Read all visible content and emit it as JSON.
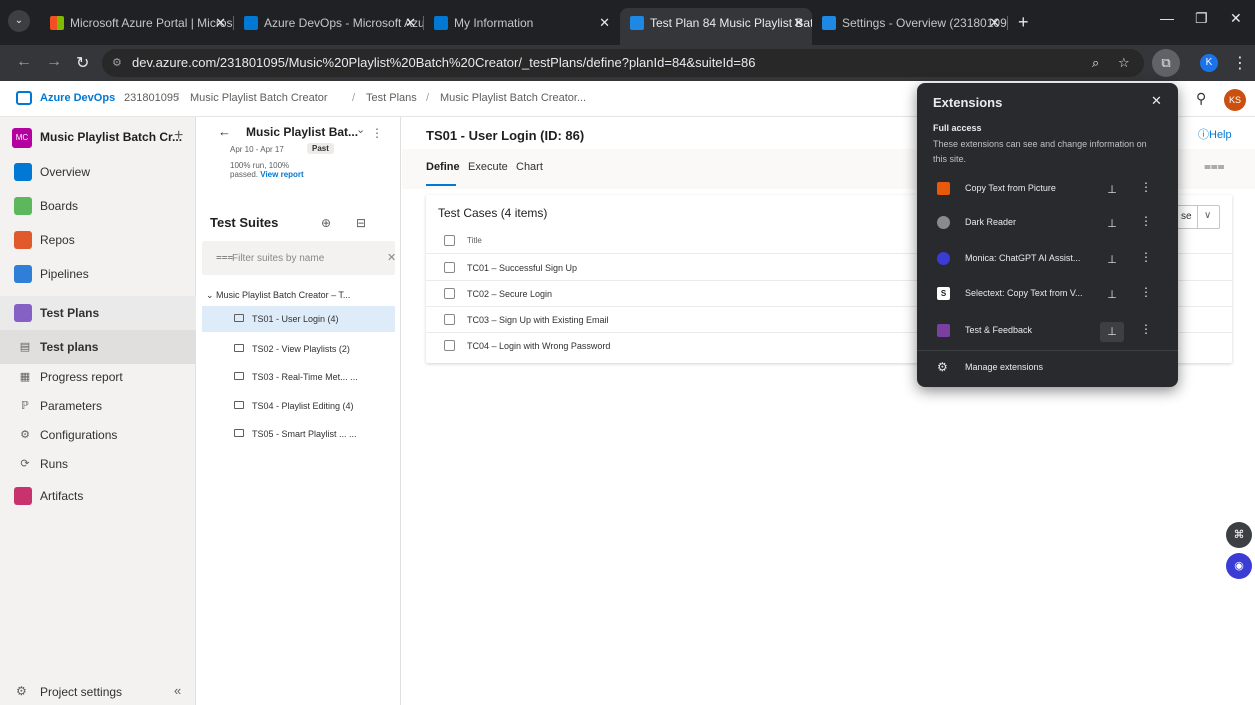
{
  "browser": {
    "tabs": [
      {
        "title": "Microsoft Azure Portal | Micros",
        "active": false
      },
      {
        "title": "Azure DevOps - Microsoft Azu",
        "active": false
      },
      {
        "title": "My Information",
        "active": false
      },
      {
        "title": "Test Plan 84 Music Playlist Batc",
        "active": true
      },
      {
        "title": "Settings - Overview (231801095",
        "active": false
      }
    ],
    "url": "dev.azure.com/231801095/Music%20Playlist%20Batch%20Creator/_testPlans/define?planId=84&suiteId=86",
    "profile_initial": "K"
  },
  "header": {
    "brand": "Azure DevOps",
    "org": "231801095",
    "breadcrumbs": [
      "Music Playlist Batch Creator",
      "Test Plans",
      "Music Playlist Batch Creator..."
    ],
    "user_initials": "KS"
  },
  "sidebar": {
    "project_initials": "MC",
    "project_name": "Music Playlist Batch Cr...",
    "items": [
      {
        "label": "Overview"
      },
      {
        "label": "Boards"
      },
      {
        "label": "Repos"
      },
      {
        "label": "Pipelines"
      },
      {
        "label": "Test Plans"
      },
      {
        "label": "Test plans"
      },
      {
        "label": "Progress report"
      },
      {
        "label": "Parameters"
      },
      {
        "label": "Configurations"
      },
      {
        "label": "Runs"
      },
      {
        "label": "Artifacts"
      }
    ],
    "project_settings": "Project settings"
  },
  "plan": {
    "title": "Music Playlist Bat...",
    "dates": "Apr 10 - Apr 17",
    "status": "Past",
    "run_info": "100% run, 100% passed.",
    "view_report": "View report",
    "suites_heading": "Test Suites",
    "filter_placeholder": "Filter suites by name",
    "root": "Music Playlist Batch Creator – T...",
    "suites": [
      {
        "label": "TS01 - User Login (4)",
        "selected": true
      },
      {
        "label": "TS02 - View Playlists (2)",
        "selected": false
      },
      {
        "label": "TS03 - Real-Time Met... ...",
        "selected": false
      },
      {
        "label": "TS04 - Playlist Editing (4)",
        "selected": false
      },
      {
        "label": "TS05 - Smart Playlist ... ...",
        "selected": false
      }
    ]
  },
  "main": {
    "title": "TS01 - User Login (ID: 86)",
    "help": "Help",
    "tabs": [
      "Define",
      "Execute",
      "Chart"
    ],
    "card_title": "Test Cases (4 items)",
    "column_title": "Title",
    "view_select": "se",
    "test_cases": [
      "TC01 – Successful Sign Up",
      "TC02 – Secure Login",
      "TC03 – Sign Up with Existing Email",
      "TC04 – Login with Wrong Password"
    ]
  },
  "extensions": {
    "title": "Extensions",
    "access_heading": "Full access",
    "access_desc": "These extensions can see and change information on this site.",
    "items": [
      {
        "name": "Copy Text from Picture",
        "color": "#e8590c",
        "glyph": "",
        "pinned": false
      },
      {
        "name": "Dark Reader",
        "color": "#8a8a8a",
        "glyph": "",
        "pinned": false
      },
      {
        "name": "Monica: ChatGPT AI Assist...",
        "color": "#3b3bd6",
        "glyph": "",
        "pinned": false
      },
      {
        "name": "Selectext: Copy Text from V...",
        "color": "#ffffff",
        "glyph": "S",
        "pinned": false
      },
      {
        "name": "Test & Feedback",
        "color": "#7b3fa0",
        "glyph": "",
        "pinned": true
      }
    ],
    "manage": "Manage extensions"
  },
  "colors": {
    "accent": "#0078d4",
    "chrome_dark": "#202124",
    "popup_bg": "#292a2d",
    "selected_suite": "#deecf9"
  }
}
